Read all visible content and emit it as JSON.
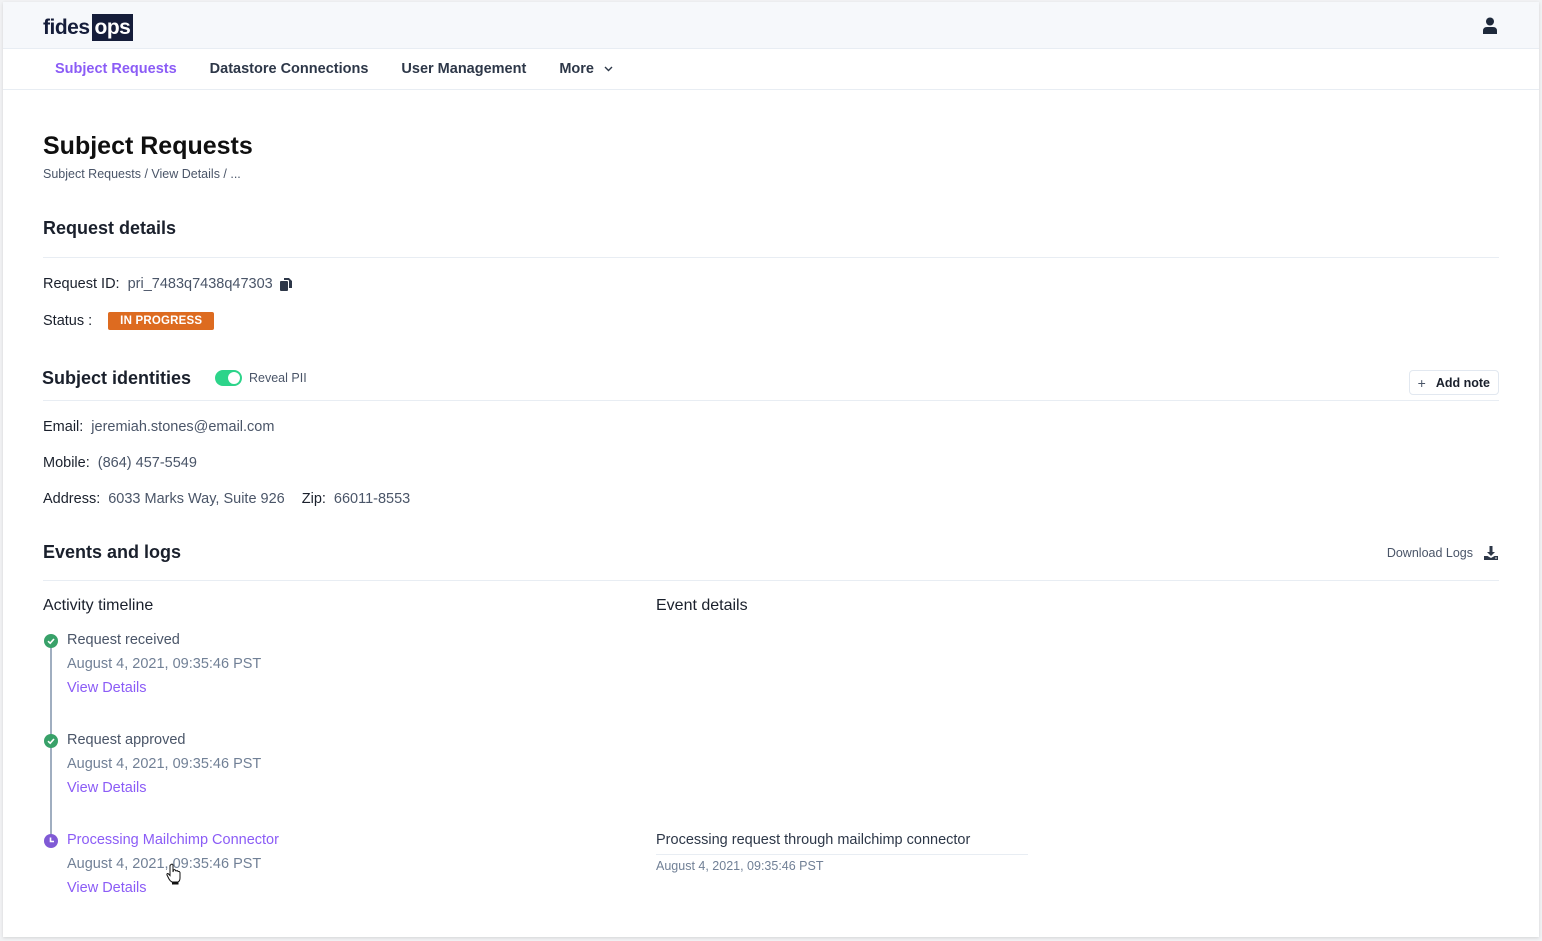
{
  "header": {
    "logo_part1": "fides",
    "logo_part2": "ops",
    "user_icon": "user-icon"
  },
  "nav": {
    "items": [
      {
        "label": "Subject Requests",
        "active": true
      },
      {
        "label": "Datastore Connections",
        "active": false
      },
      {
        "label": "User Management",
        "active": false
      },
      {
        "label": "More",
        "active": false,
        "has_dropdown": true
      }
    ]
  },
  "page": {
    "title": "Subject Requests",
    "breadcrumb": "Subject Requests / View Details / ..."
  },
  "request_details": {
    "heading": "Request details",
    "id_label": "Request ID:",
    "id_value": "pri_7483q7438q47303",
    "status_label": "Status :",
    "status_value": "IN PROGRESS",
    "status_color": "#dd6b20"
  },
  "identities": {
    "heading": "Subject identities",
    "reveal_label": "Reveal PII",
    "reveal_on": true,
    "add_note_label": "Add note",
    "email_label": "Email:",
    "email_value": "jeremiah.stones@email.com",
    "mobile_label": "Mobile:",
    "mobile_value": "(864) 457-5549",
    "address_label": "Address:",
    "address_value": "6033 Marks Way, Suite 926",
    "zip_label": "Zip:",
    "zip_value": "66011-8553"
  },
  "events": {
    "heading": "Events and logs",
    "download_label": "Download Logs",
    "timeline_heading": "Activity timeline",
    "details_heading": "Event details",
    "timeline": [
      {
        "title": "Request received",
        "time": "August 4, 2021, 09:35:46 PST",
        "link": "View Details",
        "status": "complete"
      },
      {
        "title": "Request approved",
        "time": "August 4, 2021, 09:35:46 PST",
        "link": "View Details",
        "status": "complete"
      },
      {
        "title": "Processing Mailchimp Connector",
        "time": "August 4, 2021, 09:35:46 PST",
        "link": "View Details",
        "status": "in-progress"
      }
    ],
    "detail": {
      "title": "Processing request through mailchimp connector",
      "time": "August 4, 2021, 09:35:46 PST"
    }
  },
  "colors": {
    "accent": "#8b5cf6",
    "success": "#38a169",
    "toggle": "#2dd48a",
    "navy": "#151d3a"
  }
}
